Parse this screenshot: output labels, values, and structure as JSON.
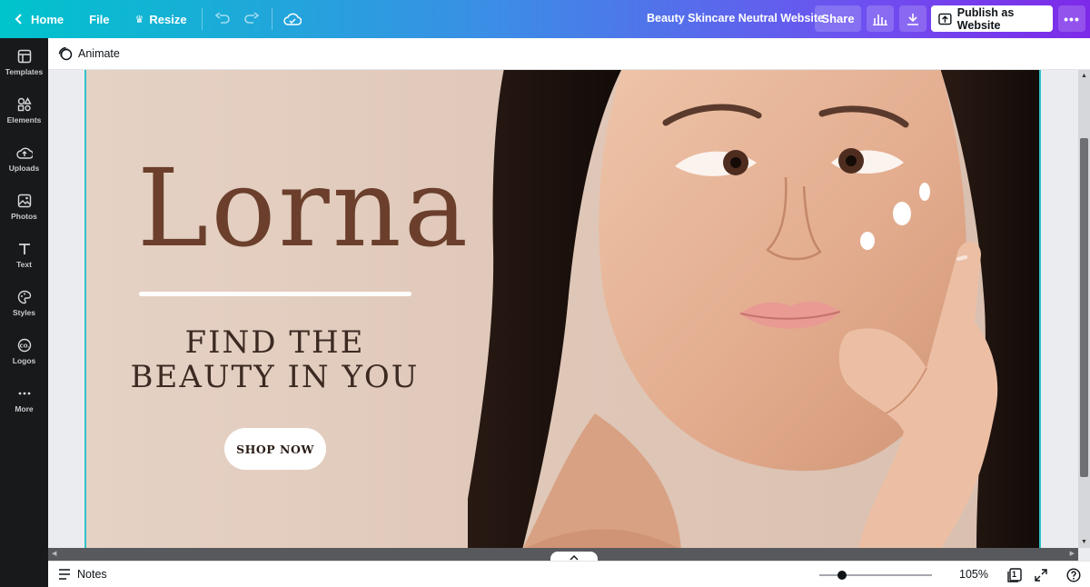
{
  "topbar": {
    "home_label": "Home",
    "file_label": "File",
    "resize_label": "Resize",
    "design_title": "Beauty Skincare Neutral Website",
    "share_label": "Share",
    "publish_label": "Publish as Website",
    "more_label": "•••"
  },
  "sidebar": {
    "items": [
      {
        "label": "Templates",
        "icon": "templates-icon"
      },
      {
        "label": "Elements",
        "icon": "elements-icon"
      },
      {
        "label": "Uploads",
        "icon": "uploads-icon"
      },
      {
        "label": "Photos",
        "icon": "photos-icon"
      },
      {
        "label": "Text",
        "icon": "text-icon"
      },
      {
        "label": "Styles",
        "icon": "styles-icon"
      },
      {
        "label": "Logos",
        "icon": "logos-icon"
      },
      {
        "label": "More",
        "icon": "more-icon"
      }
    ]
  },
  "animate_label": "Animate",
  "design": {
    "brand_name": "Lorna",
    "tagline_line1": "FIND THE",
    "tagline_line2": "BEAUTY IN YOU",
    "button_label": "SHOP NOW",
    "page_color": "#e3cbbd",
    "brand_color": "#6b3f2c"
  },
  "bottombar": {
    "notes_label": "Notes",
    "zoom_level": "105%",
    "zoom_fraction": 0.2,
    "page_number": "1"
  },
  "colors": {
    "accent": "#7d2ae8",
    "teal": "#00c4cc",
    "selection": "#30c3c9"
  }
}
